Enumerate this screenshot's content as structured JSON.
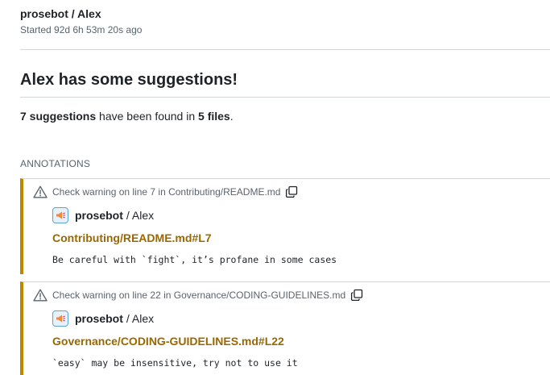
{
  "header": {
    "title_bot": "prosebot",
    "title_sep": "/",
    "title_check": "Alex",
    "started": "Started 92d 6h 53m 20s ago"
  },
  "summary": {
    "title": "Alex has some suggestions!",
    "count_bold": "7 suggestions",
    "mid_text": " have been found in ",
    "files_bold": "5 files",
    "end_text": "."
  },
  "annotations_label": "ANNOTATIONS",
  "annotations": [
    {
      "heading": "Check warning on line 7 in Contributing/README.md",
      "author": "prosebot",
      "author_rest": "/ Alex",
      "link": "Contributing/README.md#L7",
      "message": "Be careful with `fight`, it’s profane in some cases"
    },
    {
      "heading": "Check warning on line 22 in Governance/CODING-GUIDELINES.md",
      "author": "prosebot",
      "author_rest": "/ Alex",
      "link": "Governance/CODING-GUIDELINES.md#L22",
      "message": "`easy` may be insensitive, try not to use it"
    }
  ],
  "colors": {
    "warning_bar": "#bf8700",
    "link": "#9a6700",
    "muted": "#59636e"
  },
  "icons": {
    "warning": "alert-triangle-icon",
    "copy": "copy-icon",
    "avatar": "megaphone-icon"
  }
}
